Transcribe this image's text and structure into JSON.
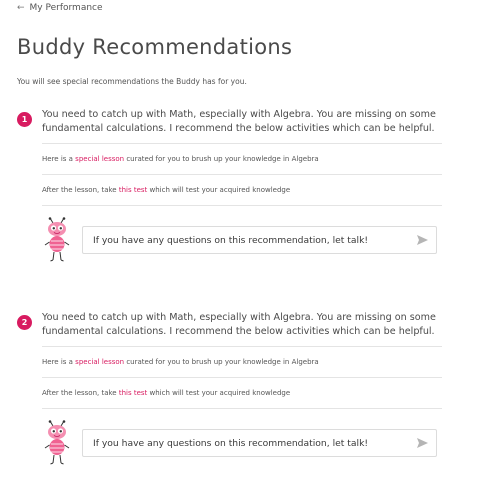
{
  "nav": {
    "back_label": "My Performance"
  },
  "page": {
    "title": "Buddy Recommendations",
    "subtitle": "You will see special recommendations the Buddy has for you."
  },
  "recommendations": [
    {
      "number": "1",
      "message": "You need to catch up with Math, especially with Algebra. You are missing on some fundamental calculations. I recommend the below activities which can be helpful.",
      "lesson_prefix": "Here is a ",
      "lesson_link": "special lesson",
      "lesson_suffix": " curated for you to brush up your knowledge in Algebra",
      "test_prefix": "After the lesson, take ",
      "test_link": "this test",
      "test_suffix": " which will test your acquired knowledge",
      "chat_text": "If you have any questions on this recommendation, let talk!"
    },
    {
      "number": "2",
      "message": "You need to catch up with Math, especially with Algebra. You are missing on some fundamental calculations. I recommend the below activities which can be helpful.",
      "lesson_prefix": "Here is a ",
      "lesson_link": "special lesson",
      "lesson_suffix": " curated for you to brush up your knowledge in Algebra",
      "test_prefix": "After the lesson, take ",
      "test_link": "this test",
      "test_suffix": " which will test your acquired knowledge",
      "chat_text": "If you have any questions on this recommendation, let talk!"
    }
  ],
  "icons": {
    "back": "arrow-left-icon",
    "send": "send-icon",
    "buddy": "buddy-mascot-icon"
  },
  "colors": {
    "accent": "#d81b60",
    "text": "#4a4a4a",
    "divider": "#e4e4e4",
    "buddy_pink": "#f48fb1"
  }
}
